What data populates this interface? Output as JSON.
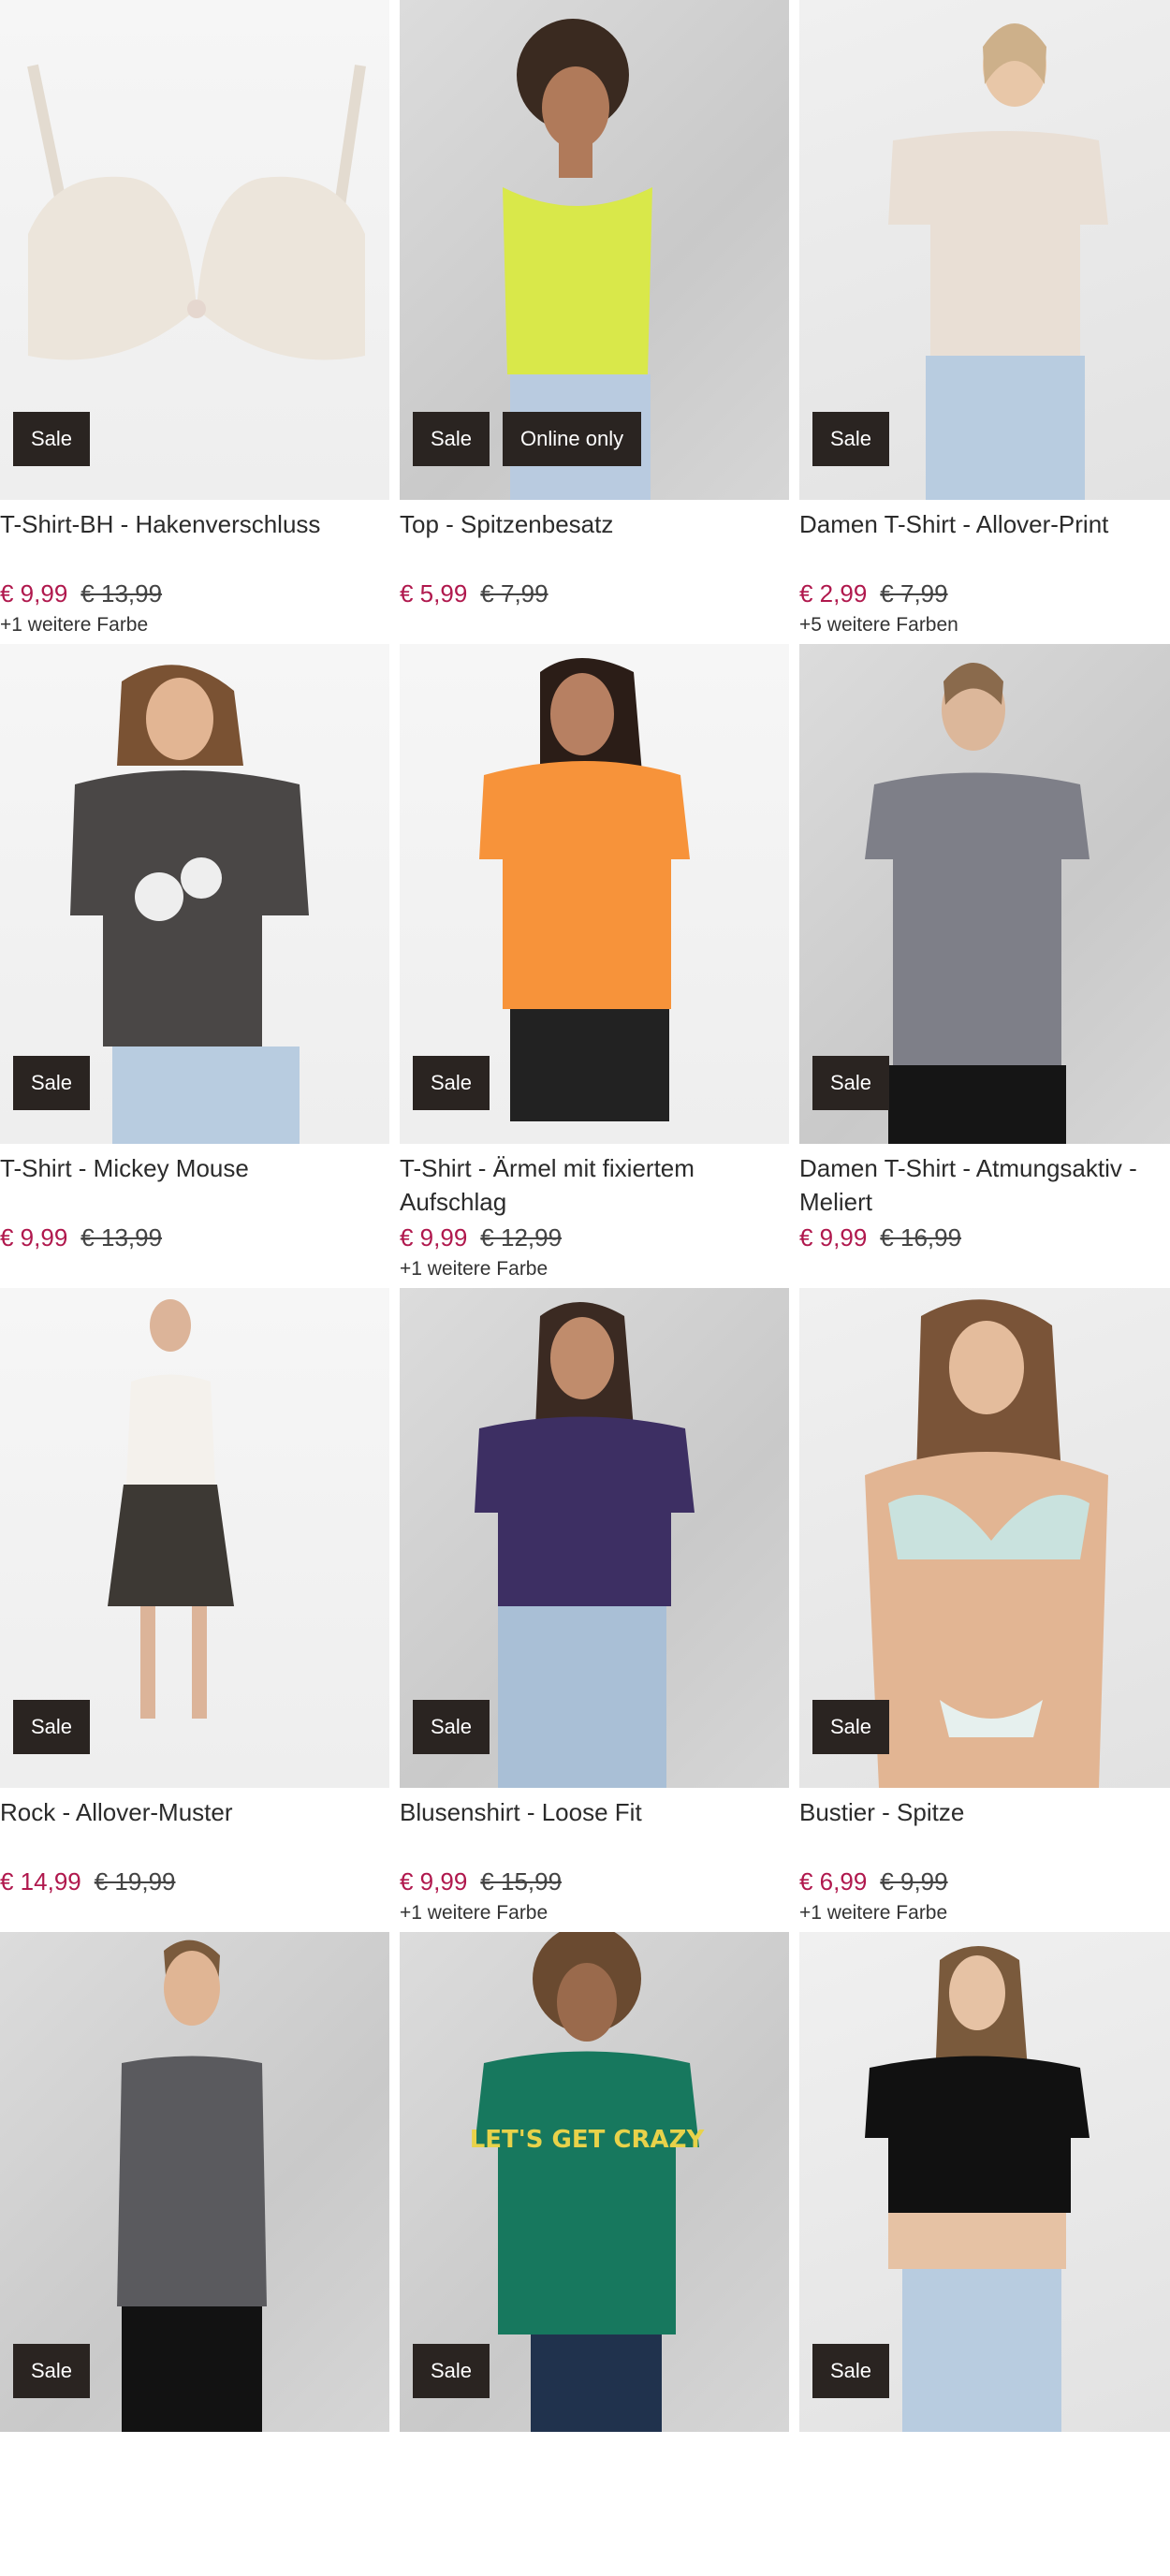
{
  "products": [
    {
      "title": "T-Shirt-BH - Hakenverschluss",
      "price": "€ 9,99",
      "old_price": "€ 13,99",
      "colors": "+1 weitere Farbe",
      "badges": [
        "Sale"
      ],
      "image": "lace-bra-image"
    },
    {
      "title": "Top - Spitzenbesatz",
      "price": "€ 5,99",
      "old_price": "€ 7,99",
      "colors": "",
      "badges": [
        "Sale",
        "Online only"
      ],
      "image": "yellow-top-image"
    },
    {
      "title": "Damen T-Shirt - Allover-Print",
      "price": "€ 2,99",
      "old_price": "€ 7,99",
      "colors": "+5 weitere Farben",
      "badges": [
        "Sale"
      ],
      "image": "feather-print-tshirt-image"
    },
    {
      "title": "T-Shirt - Mickey Mouse",
      "price": "€ 9,99",
      "old_price": "€ 13,99",
      "colors": "",
      "badges": [
        "Sale"
      ],
      "image": "mickey-tshirt-image"
    },
    {
      "title": "T-Shirt - Ärmel mit fixiertem Aufschlag",
      "price": "€ 9,99",
      "old_price": "€ 12,99",
      "colors": "+1 weitere Farbe",
      "badges": [
        "Sale"
      ],
      "image": "orange-tshirt-image"
    },
    {
      "title": "Damen T-Shirt - Atmungsaktiv - Meliert",
      "price": "€ 9,99",
      "old_price": "€ 16,99",
      "colors": "",
      "badges": [
        "Sale"
      ],
      "image": "grey-sport-tshirt-image"
    },
    {
      "title": "Rock - Allover-Muster",
      "price": "€ 14,99",
      "old_price": "€ 19,99",
      "colors": "",
      "badges": [
        "Sale"
      ],
      "image": "patterned-skirt-image"
    },
    {
      "title": "Blusenshirt - Loose Fit",
      "price": "€ 9,99",
      "old_price": "€ 15,99",
      "colors": "+1 weitere Farbe",
      "badges": [
        "Sale"
      ],
      "image": "floral-blouse-image"
    },
    {
      "title": "Bustier - Spitze",
      "price": "€ 6,99",
      "old_price": "€ 9,99",
      "colors": "+1 weitere Farbe",
      "badges": [
        "Sale"
      ],
      "image": "lace-bustier-image"
    },
    {
      "title": "",
      "price": "",
      "old_price": "",
      "colors": "",
      "badges": [
        "Sale"
      ],
      "image": "grey-tank-top-image"
    },
    {
      "title": "",
      "price": "",
      "old_price": "",
      "colors": "",
      "badges": [
        "Sale"
      ],
      "image": "green-tshirt-image"
    },
    {
      "title": "",
      "price": "",
      "old_price": "",
      "colors": "",
      "badges": [
        "Sale"
      ],
      "image": "black-crop-top-image"
    }
  ],
  "image_texts": {
    "green_tshirt_print": "LET'S GET CRAZY"
  },
  "colors": {
    "sale_price": "#b0184d",
    "badge_bg": "#2a2421",
    "badge_text": "#ffffff"
  }
}
